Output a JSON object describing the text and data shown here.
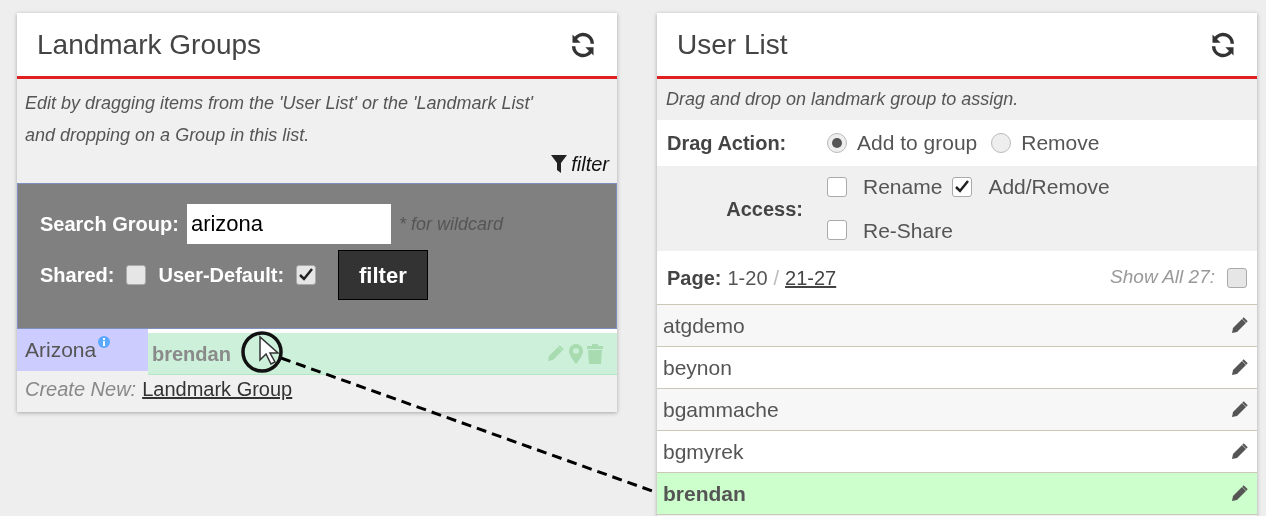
{
  "landmark_groups": {
    "title": "Landmark Groups",
    "description": "Edit by dragging items from the 'User List' or the 'Landmark List' and dropping on a Group in this list.",
    "filter_link": "filter",
    "search": {
      "label": "Search Group:",
      "value": "arizona",
      "hint": "* for wildcard"
    },
    "shared": {
      "label": "Shared:",
      "checked": false
    },
    "user_default": {
      "label": "User-Default:",
      "checked": true
    },
    "filter_button": "filter",
    "groups": [
      {
        "name": "Arizona",
        "highlighted": true
      }
    ],
    "drag_ghost": {
      "text": "brendan"
    },
    "create_new": {
      "label": "Create New:",
      "link": "Landmark Group"
    }
  },
  "user_list": {
    "title": "User List",
    "description": "Drag and drop on landmark group to assign.",
    "drag_action": {
      "label": "Drag Action:",
      "options": [
        {
          "label": "Add to group",
          "selected": true
        },
        {
          "label": "Remove",
          "selected": false
        }
      ]
    },
    "access": {
      "label": "Access:",
      "options": [
        {
          "label": "Rename",
          "checked": false
        },
        {
          "label": "Add/Remove",
          "checked": true
        },
        {
          "label": "Re-Share",
          "checked": false
        }
      ]
    },
    "page": {
      "label": "Page:",
      "current": "1-20",
      "separator": "/",
      "next": "21-27"
    },
    "show_all": {
      "label": "Show All 27:",
      "checked": false
    },
    "users": [
      {
        "name": "atgdemo",
        "selected": false
      },
      {
        "name": "beynon",
        "selected": false
      },
      {
        "name": "bgammache",
        "selected": false
      },
      {
        "name": "bgmyrek",
        "selected": false
      },
      {
        "name": "brendan",
        "selected": true
      }
    ]
  }
}
